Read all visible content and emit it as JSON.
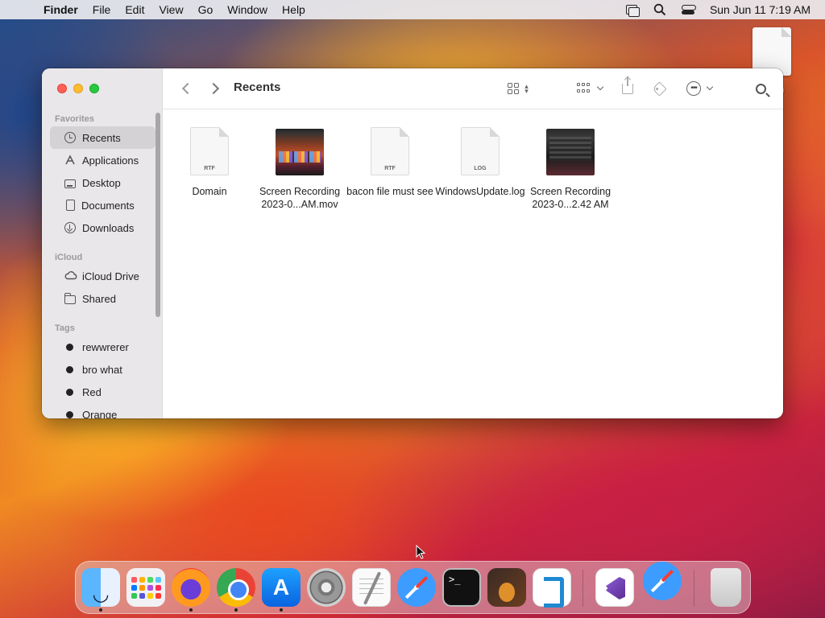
{
  "menubar": {
    "app_name": "Finder",
    "menus": [
      "File",
      "Edit",
      "View",
      "Go",
      "Window",
      "Help"
    ],
    "clock": "Sun Jun 11  7:19 AM"
  },
  "desktop": {
    "file_label": "n"
  },
  "window": {
    "title": "Recents",
    "sidebar": {
      "favorites_header": "Favorites",
      "favorites": [
        {
          "label": "Recents",
          "icon": "clock-icon"
        },
        {
          "label": "Applications",
          "icon": "applications-icon"
        },
        {
          "label": "Desktop",
          "icon": "desktop-icon"
        },
        {
          "label": "Documents",
          "icon": "document-icon"
        },
        {
          "label": "Downloads",
          "icon": "download-icon"
        }
      ],
      "icloud_header": "iCloud",
      "icloud": [
        {
          "label": "iCloud Drive",
          "icon": "cloud-icon"
        },
        {
          "label": "Shared",
          "icon": "shared-folder-icon"
        }
      ],
      "tags_header": "Tags",
      "tags": [
        "rewwrerer",
        "bro what",
        "Red",
        "Orange"
      ]
    },
    "files": [
      {
        "label": "Domain",
        "kind": "RTF"
      },
      {
        "label": "Screen Recording 2023-0...AM.mov",
        "kind": "video"
      },
      {
        "label": "bacon file must see",
        "kind": "RTF"
      },
      {
        "label": "WindowsUpdate.log",
        "kind": "LOG"
      },
      {
        "label": "Screen Recording 2023-0...2.42 AM",
        "kind": "video"
      }
    ]
  },
  "dock": {
    "apps": [
      "Finder",
      "Launchpad",
      "Firefox",
      "Chrome",
      "App Store",
      "System Settings",
      "TextEdit",
      "Safari",
      "Terminal",
      "GarageBand",
      "Visual Studio Code",
      "Visual Studio",
      "Safari",
      "Trash"
    ],
    "terminal_prompt": ">_"
  }
}
